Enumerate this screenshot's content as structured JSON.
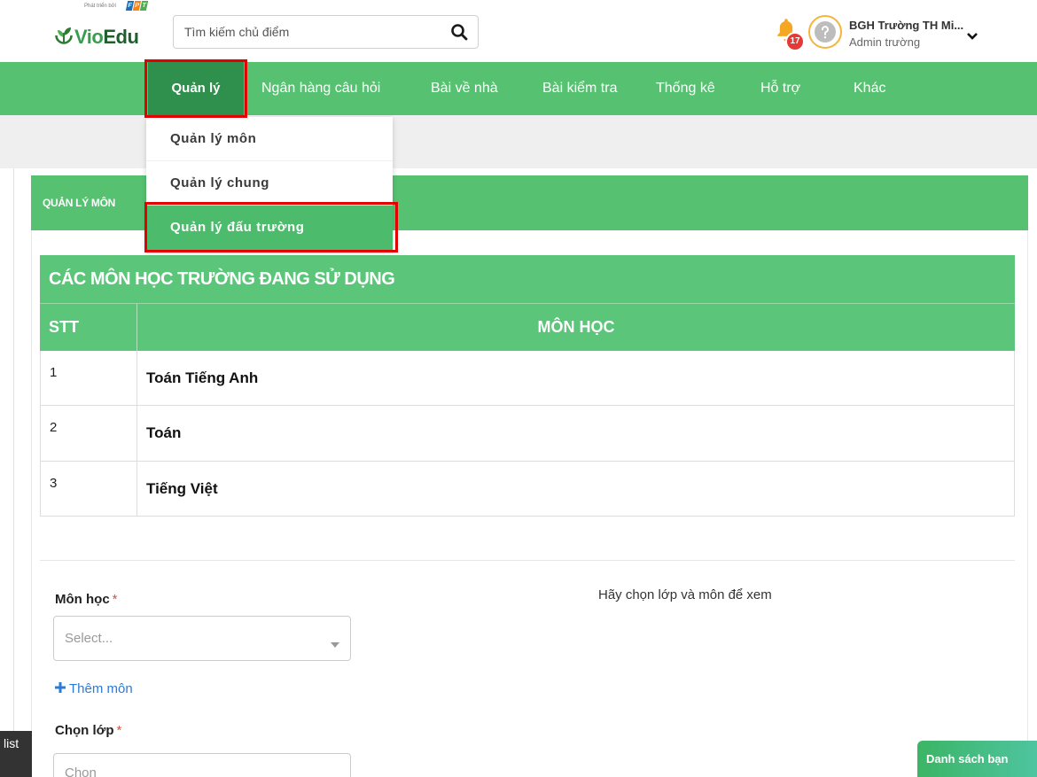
{
  "header": {
    "logo": {
      "tagline": "Phát triển bởi",
      "brand_letters": [
        "F",
        "P",
        "T"
      ],
      "name_part1": "Vio",
      "name_part2": "Edu",
      "icon": "sprout-icon"
    },
    "search": {
      "placeholder": "Tìm kiếm chủ điểm",
      "icon": "search-icon"
    },
    "notifications": {
      "icon": "bell-icon",
      "count": "17"
    },
    "user": {
      "avatar_icon": "question-icon",
      "name": "BGH Trường TH Mi...",
      "role": "Admin trường",
      "menu_icon": "chevron-down-icon"
    }
  },
  "nav": {
    "items": [
      {
        "label": "Quản lý",
        "active": true
      },
      {
        "label": "Ngân hàng câu hỏi"
      },
      {
        "label": "Bài về nhà"
      },
      {
        "label": "Bài kiểm tra"
      },
      {
        "label": "Thống kê"
      },
      {
        "label": "Hỗ trợ"
      },
      {
        "label": "Khác"
      }
    ]
  },
  "dropdown": {
    "items": [
      {
        "label": "Quản lý môn"
      },
      {
        "label": "Quản lý chung"
      },
      {
        "label": "Quản lý đấu trường",
        "highlighted": true
      }
    ]
  },
  "panel": {
    "title": "QUẢN LÝ MÔN"
  },
  "subjects_table": {
    "title": "CÁC MÔN HỌC TRƯỜNG ĐANG SỬ DỤNG",
    "columns": [
      "STT",
      "MÔN HỌC"
    ],
    "rows": [
      [
        "1",
        "Toán Tiếng Anh"
      ],
      [
        "2",
        "Toán"
      ],
      [
        "3",
        "Tiếng Việt"
      ]
    ]
  },
  "form": {
    "subject": {
      "label": "Môn học",
      "required": "*",
      "placeholder": "Select...",
      "icon": "caret-down-icon"
    },
    "hint": "Hãy chọn lớp và môn để xem",
    "add_subject": {
      "icon": "plus-icon",
      "label": "Thêm môn"
    },
    "class": {
      "label": "Chọn lớp",
      "required": "*",
      "placeholder": "Chọn",
      "icon": "caret-down-icon"
    }
  },
  "footer": {
    "left_tab": "list",
    "right_tab": "Danh sách bạn"
  },
  "colors": {
    "green": "#56c271",
    "green-dark": "#2f8f4c",
    "green-table": "#5bc57a",
    "green-menu": "#4cbb6b",
    "red": "#e30000",
    "link": "#2b7bd6"
  }
}
